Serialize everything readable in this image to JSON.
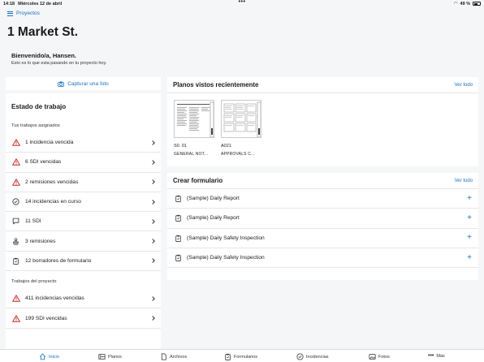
{
  "status": {
    "time": "14:18",
    "date": "Miércoles 12 de abril",
    "battery": "49 %"
  },
  "nav": {
    "projects_label": "Proyectos"
  },
  "page": {
    "title": "1 Market St.",
    "welcome": "Bienvenido/a, Hansen.",
    "subtitle": "Esto es lo que esta pasando en tu proyecto hoy."
  },
  "left": {
    "capture_label": "Capturar una foto",
    "work_state_title": "Estado de trabajo",
    "assigned_label": "Tus trabajos asignados",
    "assigned_items": [
      {
        "label": "1 incidencia vencida",
        "icon": "warning-icon"
      },
      {
        "label": "6 SDI vencidas",
        "icon": "warning-icon"
      },
      {
        "label": "2 remisiones vencidas",
        "icon": "warning-icon"
      },
      {
        "label": "14 incidencias en curso",
        "icon": "check-circle-icon"
      },
      {
        "label": "11 SDI",
        "icon": "chat-icon"
      },
      {
        "label": "3 remisiones",
        "icon": "stamp-icon"
      },
      {
        "label": "12 borradores de formulario",
        "icon": "clipboard-icon"
      }
    ],
    "project_label": "Trabajos del proyecto",
    "project_items": [
      {
        "label": "411 incidencias vencidas",
        "icon": "warning-icon"
      },
      {
        "label": "199 SDI vencidas",
        "icon": "warning-icon"
      }
    ]
  },
  "plans": {
    "title": "Planos vistos recientemente",
    "view_all": "Ver todo",
    "items": [
      {
        "number": "S0. 01",
        "name": "GENERAL NOT..."
      },
      {
        "number": "A021",
        "name": "APPROVALS C..."
      }
    ]
  },
  "forms": {
    "title": "Crear formulario",
    "view_all": "Ver todo",
    "items": [
      {
        "label": "(Sample) Daily Report"
      },
      {
        "label": "(Sample) Daily Report"
      },
      {
        "label": "(Sample) Daily Safety Inspection"
      },
      {
        "label": "(Sample) Daily Safety Inspection"
      }
    ]
  },
  "tabs": [
    {
      "label": "Inicio",
      "icon": "home-icon",
      "active": true
    },
    {
      "label": "Planos",
      "icon": "plans-icon"
    },
    {
      "label": "Archivos",
      "icon": "file-icon"
    },
    {
      "label": "Formularios",
      "icon": "clipboard-icon"
    },
    {
      "label": "Incidencias",
      "icon": "check-circle-icon"
    },
    {
      "label": "Fotos",
      "icon": "photo-icon"
    },
    {
      "label": "Más",
      "icon": "more-icon"
    }
  ],
  "colors": {
    "accent": "#1b6fbf",
    "warning": "#c62828",
    "background": "#f5f6f7"
  }
}
